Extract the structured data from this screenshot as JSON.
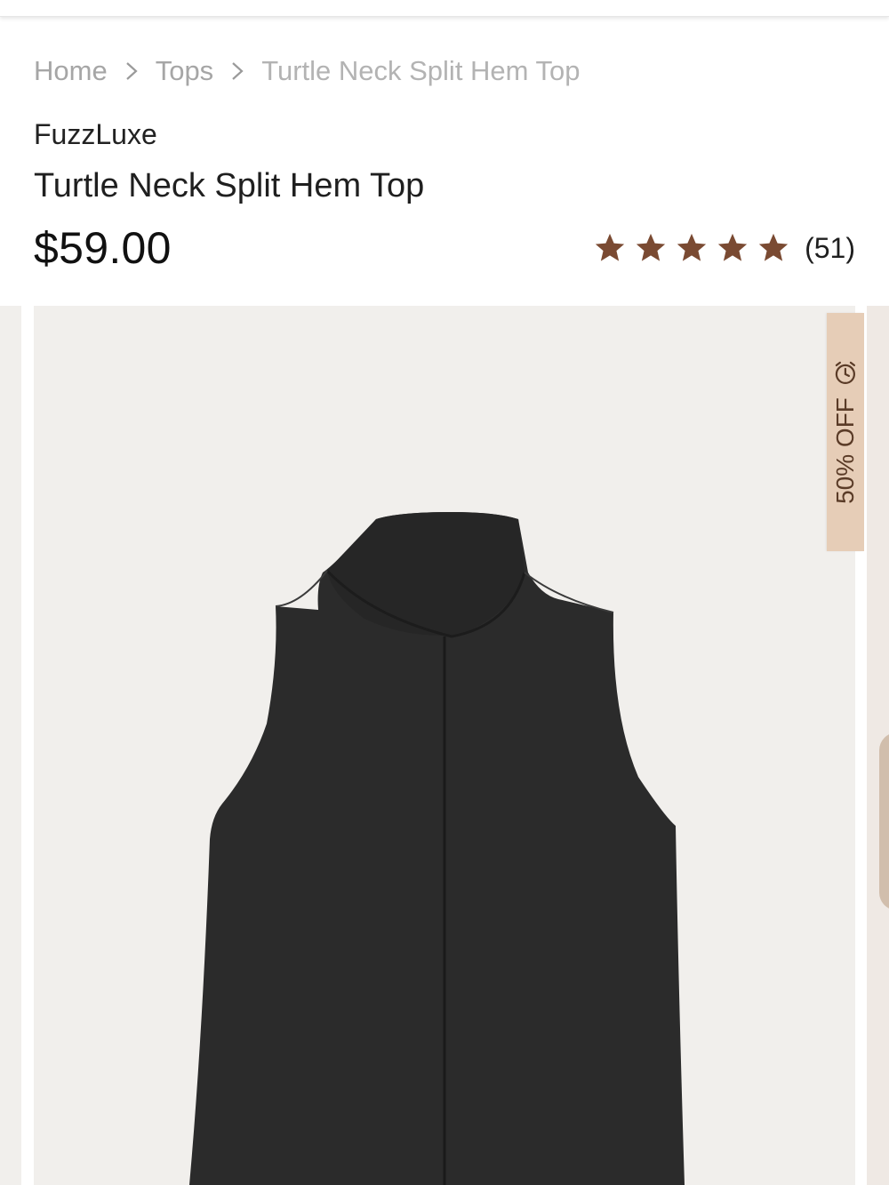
{
  "breadcrumb": {
    "items": [
      {
        "label": "Home"
      },
      {
        "label": "Tops"
      },
      {
        "label": "Turtle Neck Split Hem Top"
      }
    ]
  },
  "product": {
    "brand": "FuzzLuxe",
    "title": "Turtle Neck Split Hem Top",
    "price": "$59.00",
    "rating": {
      "stars": 5,
      "count": "(51)"
    }
  },
  "gallery": {
    "badge": {
      "text": "50% OFF",
      "icon": "alarm-clock-icon"
    }
  },
  "colors": {
    "star": "#7a4a32",
    "badge_bg": "#e6cdb7",
    "badge_text": "#5a3b27",
    "image_bg": "#f1efec",
    "garment": "#2b2b2b"
  }
}
